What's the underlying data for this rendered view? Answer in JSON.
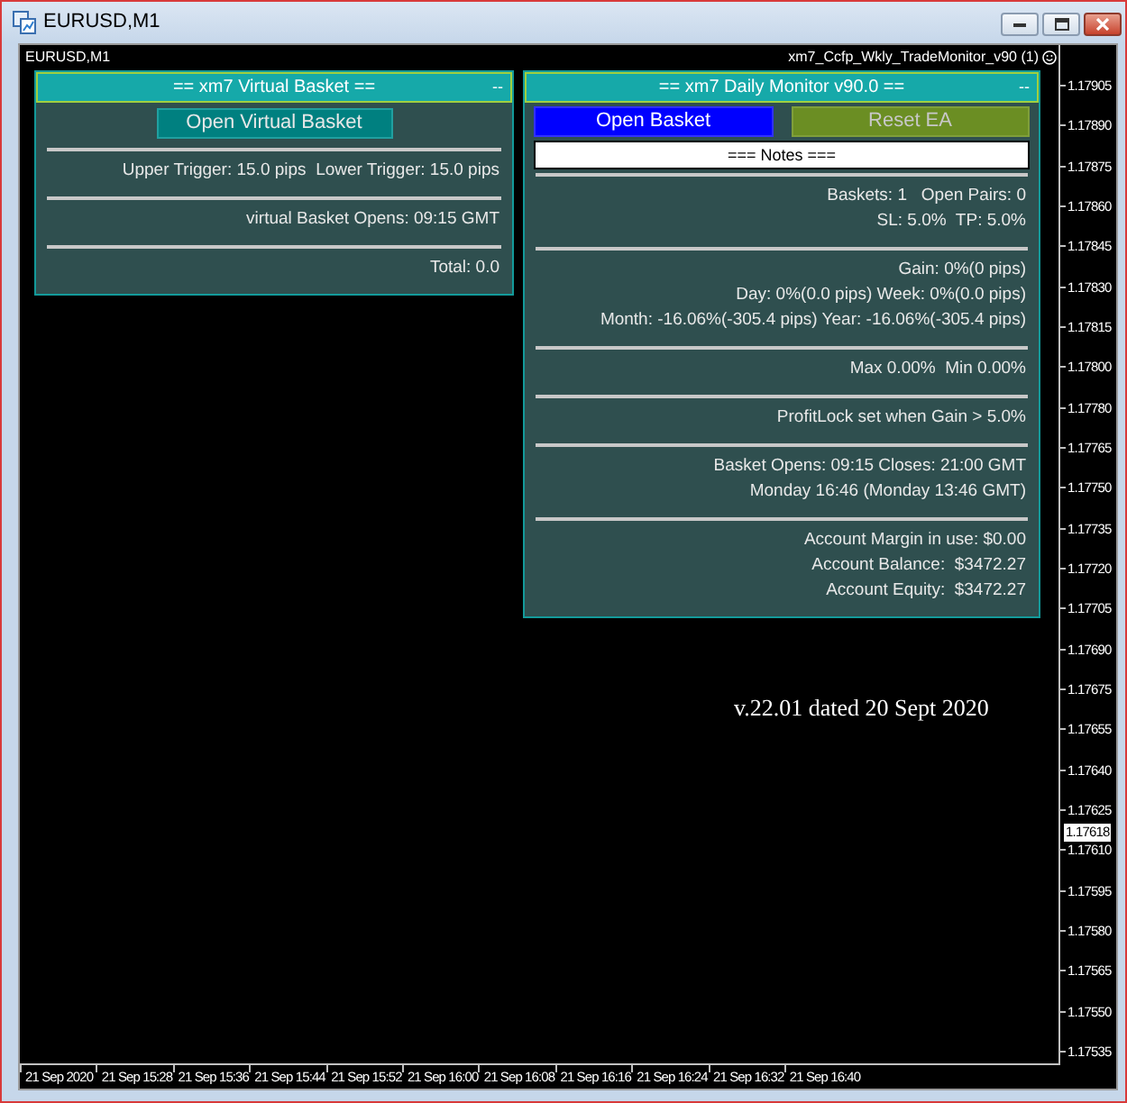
{
  "window": {
    "title": "EURUSD,M1"
  },
  "chart": {
    "symbol_label": "EURUSD,M1",
    "indicator_label": "xm7_Ccfp_Wkly_TradeMonitor_v90 (1)",
    "price_axis": [
      "1.17905",
      "1.17890",
      "1.17875",
      "1.17860",
      "1.17845",
      "1.17830",
      "1.17815",
      "1.17800",
      "1.17780",
      "1.17765",
      "1.17750",
      "1.17735",
      "1.17720",
      "1.17705",
      "1.17690",
      "1.17675",
      "1.17655",
      "1.17640",
      "1.17625",
      "1.17610",
      "1.17595",
      "1.17580",
      "1.17565",
      "1.17550",
      "1.17535"
    ],
    "current_price": "1.17618",
    "time_axis": [
      "21 Sep 2020",
      "21 Sep 15:28",
      "21 Sep 15:36",
      "21 Sep 15:44",
      "21 Sep 15:52",
      "21 Sep 16:00",
      "21 Sep 16:08",
      "21 Sep 16:16",
      "21 Sep 16:24",
      "21 Sep 16:32",
      "21 Sep 16:40"
    ],
    "version_note": "v.22.01 dated 20 Sept 2020"
  },
  "virtual_basket_panel": {
    "title": "== xm7 Virtual Basket ==",
    "minimize": "--",
    "button": "Open Virtual Basket",
    "sections": [
      {
        "lines": [
          "Upper Trigger: 15.0 pips  Lower Trigger: 15.0 pips"
        ]
      },
      {
        "lines": [
          "virtual Basket Opens: 09:15 GMT"
        ]
      },
      {
        "lines": [
          "Total: 0.0"
        ]
      }
    ]
  },
  "daily_monitor_panel": {
    "title": "== xm7 Daily Monitor v90.0 ==",
    "minimize": "--",
    "buttons": [
      {
        "label": "Open Basket",
        "kind": "primary"
      },
      {
        "label": "Reset EA",
        "kind": "secondary"
      }
    ],
    "notes": "=== Notes ===",
    "sections": [
      {
        "lines": [
          "Baskets: 1   Open Pairs: 0",
          "SL: 5.0%  TP: 5.0%"
        ]
      },
      {
        "lines": [
          "Gain: 0%(0 pips)",
          "Day: 0%(0.0 pips) Week: 0%(0.0 pips)",
          "Month: -16.06%(-305.4 pips) Year: -16.06%(-305.4 pips)"
        ]
      },
      {
        "lines": [
          "Max 0.00%  Min 0.00%"
        ]
      },
      {
        "lines": [
          "ProfitLock set when Gain > 5.0%"
        ]
      },
      {
        "lines": [
          "Basket Opens: 09:15 Closes: 21:00 GMT",
          "Monday 16:46 (Monday 13:46 GMT)"
        ]
      },
      {
        "lines": [
          "Account Margin in use: $0.00",
          "Account Balance:  $3472.27",
          "Account Equity:  $3472.27"
        ]
      }
    ]
  }
}
